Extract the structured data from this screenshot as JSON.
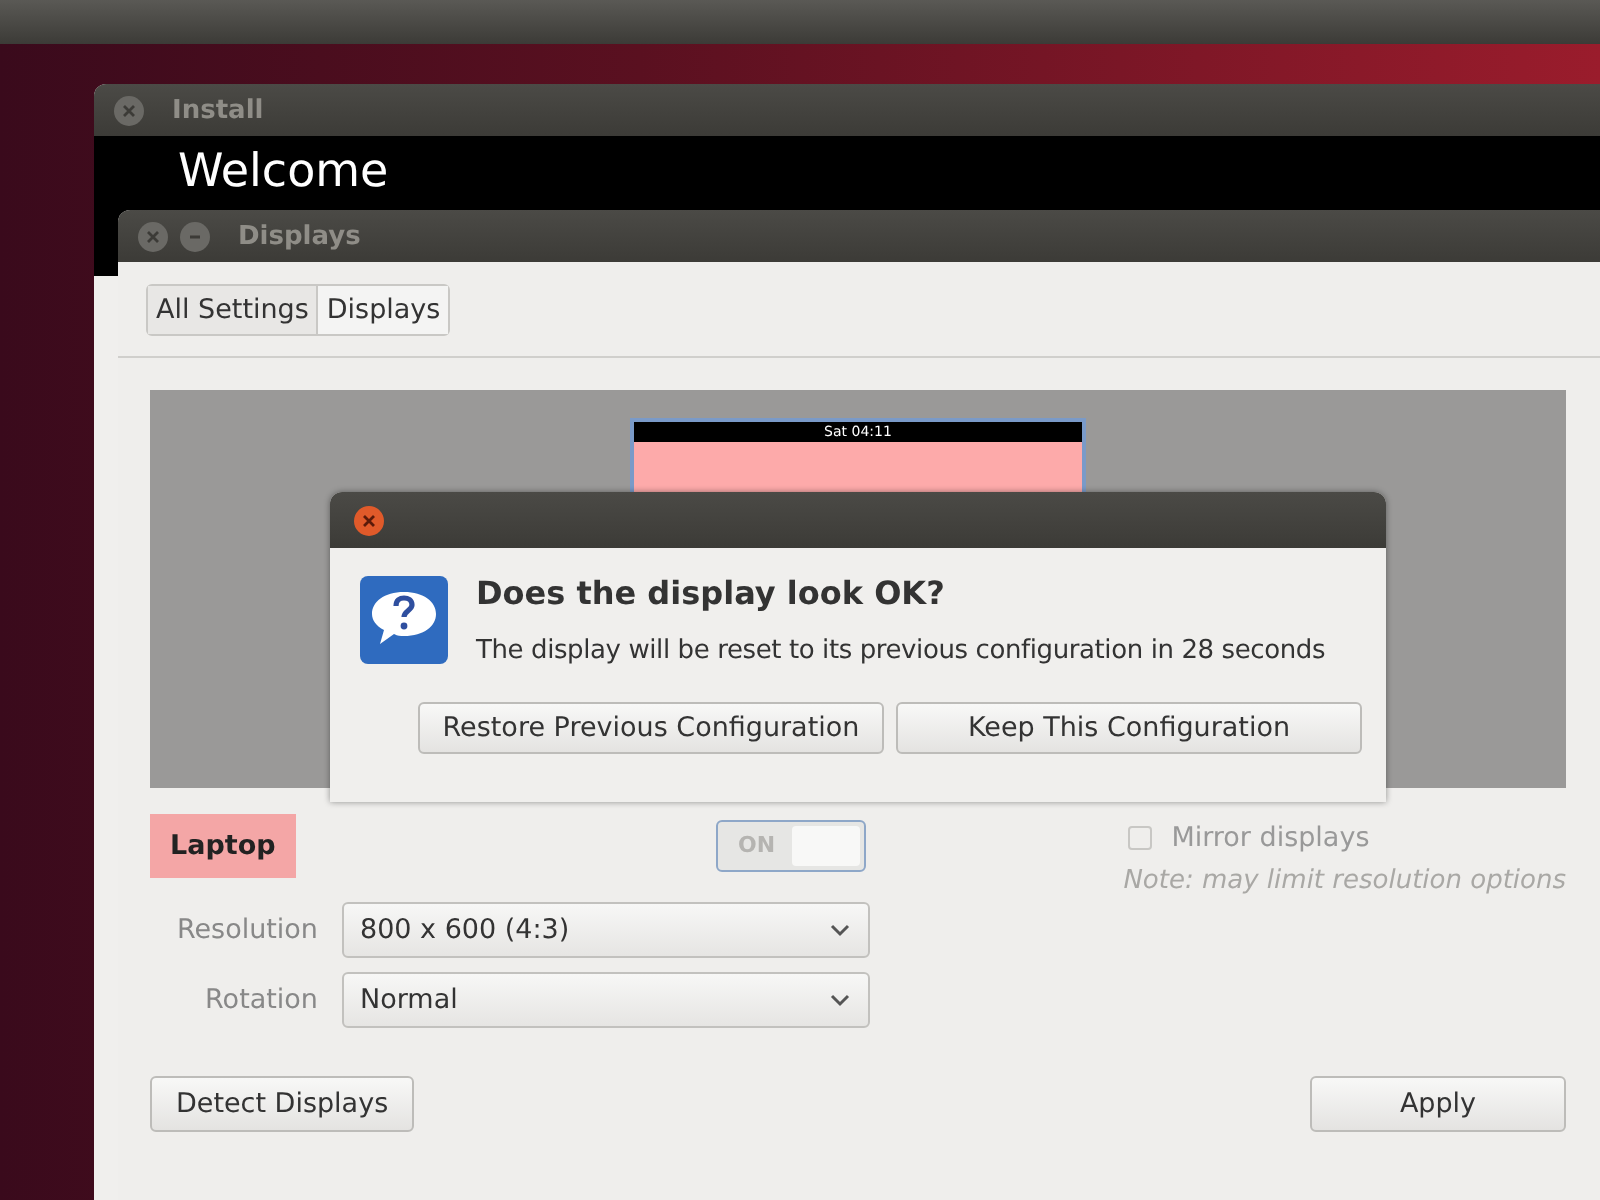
{
  "install_window": {
    "title": "Install",
    "heading": "Welcome"
  },
  "displays_window": {
    "title": "Displays",
    "breadcrumb": [
      {
        "label": "All Settings",
        "selected": false
      },
      {
        "label": "Displays",
        "selected": true
      }
    ],
    "preview": {
      "clock": "Sat 04:11"
    },
    "display_name": "Laptop",
    "power": {
      "label": "ON",
      "on": true
    },
    "mirror": {
      "label": "Mirror displays",
      "checked": false,
      "disabled": true
    },
    "note": "Note: may limit resolution options",
    "settings": [
      {
        "label": "Resolution",
        "value": "800 x 600 (4:3)"
      },
      {
        "label": "Rotation",
        "value": "Normal"
      }
    ],
    "buttons": [
      "Detect Displays",
      "Apply"
    ]
  },
  "dialog": {
    "heading": "Does the display look OK?",
    "message": "The display will be reset to its previous configuration in 28 seconds",
    "buttons": [
      "Restore Previous Configuration",
      "Keep This Configuration"
    ]
  }
}
